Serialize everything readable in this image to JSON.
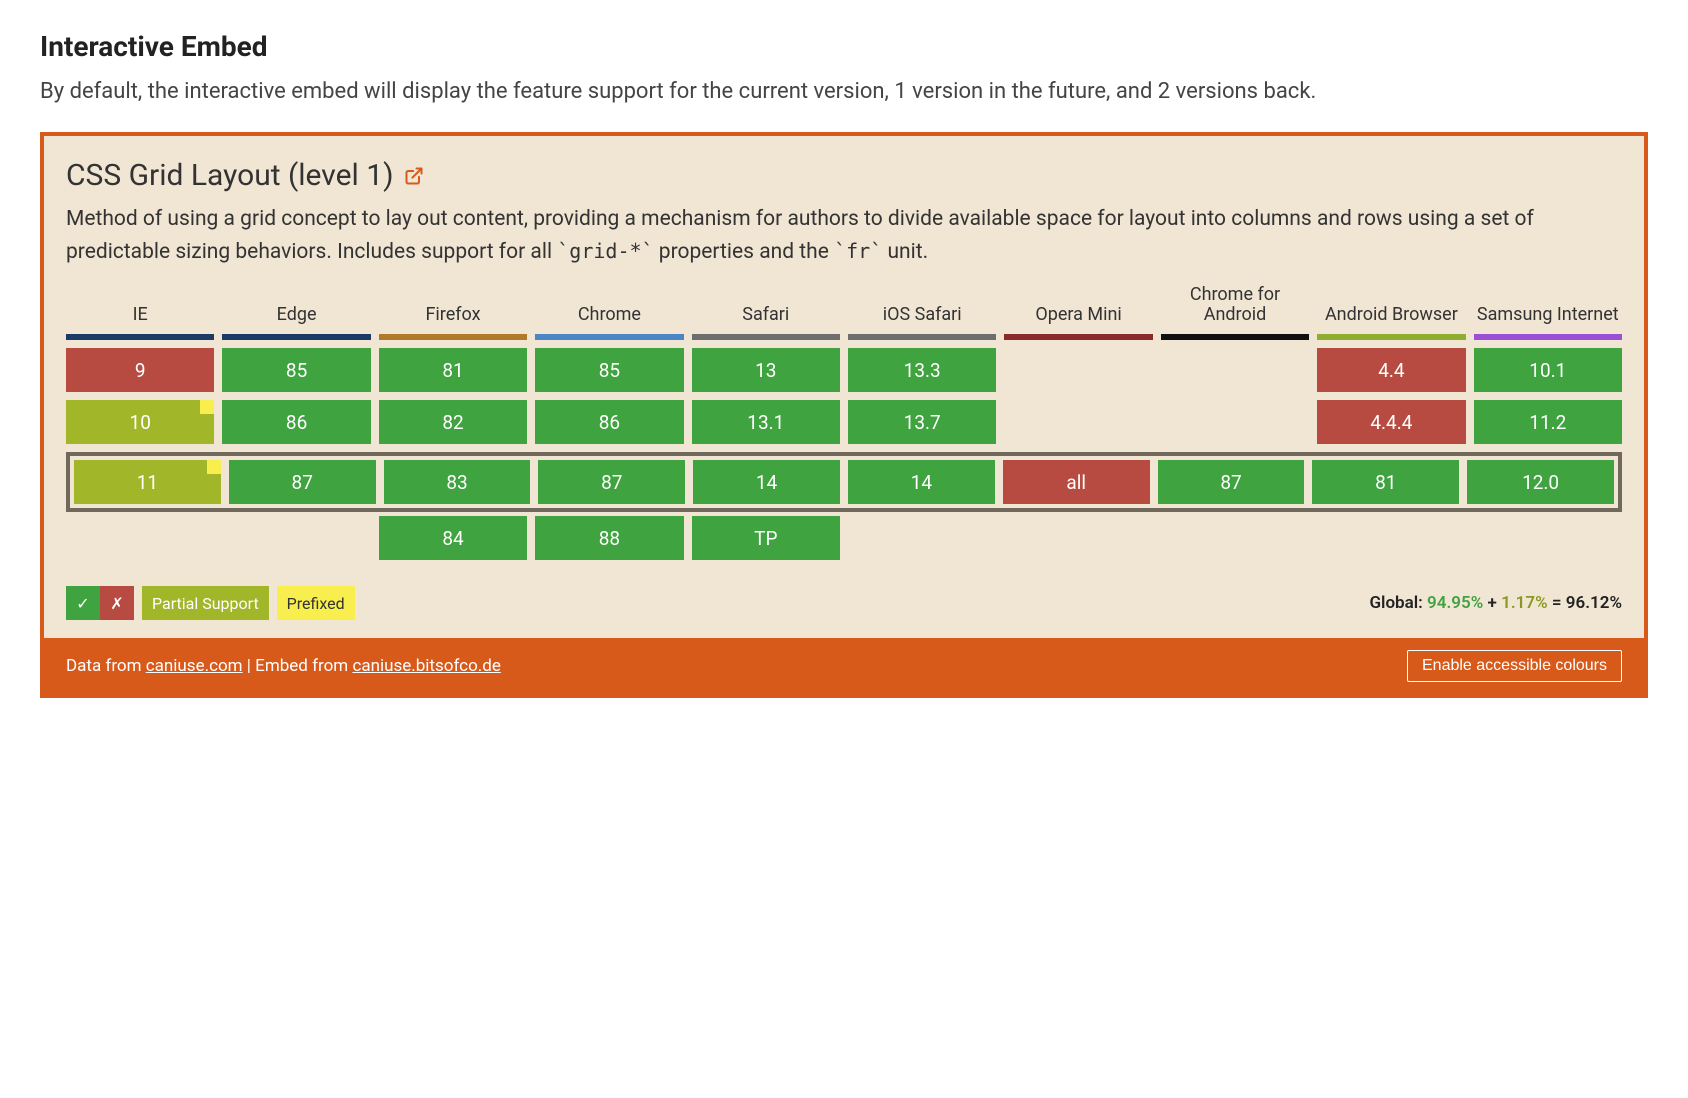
{
  "page": {
    "section_title": "Interactive Embed",
    "section_desc": "By default, the interactive embed will display the feature support for the current version, 1 version in the future, and 2 versions back."
  },
  "embed": {
    "feature_title": "CSS Grid Layout (level 1)",
    "feature_desc_pre": "Method of using a grid concept to lay out content, providing a mechanism for authors to divide available space for layout into columns and rows using a set of predictable sizing behaviors. Includes support for all ",
    "feature_code1": "`grid-*`",
    "feature_desc_mid": " properties and the ",
    "feature_code2": "`fr`",
    "feature_desc_post": " unit.",
    "browsers": [
      {
        "name": "IE",
        "accent": "#1b3a66"
      },
      {
        "name": "Edge",
        "accent": "#1b3a66"
      },
      {
        "name": "Firefox",
        "accent": "#b07a2a"
      },
      {
        "name": "Chrome",
        "accent": "#4a86c5"
      },
      {
        "name": "Safari",
        "accent": "#6e6e6e"
      },
      {
        "name": "iOS Safari",
        "accent": "#6e6e6e"
      },
      {
        "name": "Opera Mini",
        "accent": "#8a2a2a"
      },
      {
        "name": "Chrome for Android",
        "accent": "#111111"
      },
      {
        "name": "Android Browser",
        "accent": "#8fae2f"
      },
      {
        "name": "Samsung Internet",
        "accent": "#9b4fd6"
      }
    ],
    "rows_above": [
      [
        {
          "v": "9",
          "s": "unsupported"
        },
        {
          "v": "85",
          "s": "supported"
        },
        {
          "v": "81",
          "s": "supported"
        },
        {
          "v": "85",
          "s": "supported"
        },
        {
          "v": "13",
          "s": "supported"
        },
        {
          "v": "13.3",
          "s": "supported"
        },
        {
          "v": "",
          "s": "empty"
        },
        {
          "v": "",
          "s": "empty"
        },
        {
          "v": "4.4",
          "s": "unsupported"
        },
        {
          "v": "10.1",
          "s": "supported"
        }
      ],
      [
        {
          "v": "10",
          "s": "partial",
          "prefixed": true
        },
        {
          "v": "86",
          "s": "supported"
        },
        {
          "v": "82",
          "s": "supported"
        },
        {
          "v": "86",
          "s": "supported"
        },
        {
          "v": "13.1",
          "s": "supported"
        },
        {
          "v": "13.7",
          "s": "supported"
        },
        {
          "v": "",
          "s": "empty"
        },
        {
          "v": "",
          "s": "empty"
        },
        {
          "v": "4.4.4",
          "s": "unsupported"
        },
        {
          "v": "11.2",
          "s": "supported"
        }
      ]
    ],
    "row_current": [
      {
        "v": "11",
        "s": "partial",
        "prefixed": true
      },
      {
        "v": "87",
        "s": "supported"
      },
      {
        "v": "83",
        "s": "supported"
      },
      {
        "v": "87",
        "s": "supported"
      },
      {
        "v": "14",
        "s": "supported"
      },
      {
        "v": "14",
        "s": "supported"
      },
      {
        "v": "all",
        "s": "unsupported"
      },
      {
        "v": "87",
        "s": "supported"
      },
      {
        "v": "81",
        "s": "supported"
      },
      {
        "v": "12.0",
        "s": "supported"
      }
    ],
    "rows_below": [
      [
        {
          "v": "",
          "s": "empty"
        },
        {
          "v": "",
          "s": "empty"
        },
        {
          "v": "84",
          "s": "supported"
        },
        {
          "v": "88",
          "s": "supported"
        },
        {
          "v": "TP",
          "s": "supported"
        },
        {
          "v": "",
          "s": "empty"
        },
        {
          "v": "",
          "s": "empty"
        },
        {
          "v": "",
          "s": "empty"
        },
        {
          "v": "",
          "s": "empty"
        },
        {
          "v": "",
          "s": "empty"
        }
      ]
    ],
    "legend": {
      "check": "✓",
      "cross": "✗",
      "partial": "Partial Support",
      "prefixed": "Prefixed"
    },
    "global": {
      "label": "Global:",
      "supported_pct": "94.95%",
      "plus": "+",
      "partial_pct": "1.17%",
      "equals": "=",
      "total_pct": "96.12%"
    },
    "footer": {
      "prefix": "Data from ",
      "link1": "caniuse.com",
      "sep": " | Embed from ",
      "link2": "caniuse.bitsofco.de",
      "button": "Enable accessible colours"
    }
  }
}
